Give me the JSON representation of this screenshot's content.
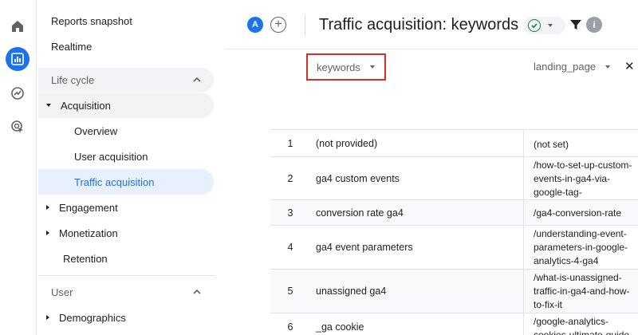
{
  "nav": {
    "top_items": [
      "Reports snapshot",
      "Realtime"
    ],
    "lifecycle": {
      "label": "Life cycle",
      "acquisition": {
        "label": "Acquisition",
        "children": [
          "Overview",
          "User acquisition",
          "Traffic acquisition"
        ]
      },
      "engagement": "Engagement",
      "monetization": "Monetization",
      "retention": "Retention"
    },
    "user": {
      "label": "User",
      "demographics": "Demographics"
    }
  },
  "header": {
    "avatar_letter": "A",
    "add_symbol": "+",
    "title": "Traffic acquisition: keywords",
    "info_symbol": "i"
  },
  "dimensions": {
    "primary": "keywords",
    "secondary": "landing_page",
    "close_symbol": "✕"
  },
  "table": {
    "rows": [
      {
        "n": "1",
        "keyword": "(not provided)",
        "landing": "(not set)"
      },
      {
        "n": "2",
        "keyword": "ga4 custom events",
        "landing": "/how-to-set-up-custom-events-in-ga4-via-google-tag-"
      },
      {
        "n": "3",
        "keyword": "conversion rate ga4",
        "landing": "/ga4-conversion-rate"
      },
      {
        "n": "4",
        "keyword": "ga4 event parameters",
        "landing": "/understanding-event-parameters-in-google-analytics-4-ga4"
      },
      {
        "n": "5",
        "keyword": "unassigned ga4",
        "landing": "/what-is-unassigned-traffic-in-ga4-and-how-to-fix-it"
      },
      {
        "n": "6",
        "keyword": "_ga cookie",
        "landing": "/google-analytics-cookies-ultimate-guide"
      }
    ]
  },
  "colors": {
    "accent": "#1a73e8",
    "highlight_border": "#d93025",
    "status_ok": "#188038"
  },
  "icons": [
    "home-icon",
    "reports-icon",
    "explore-icon",
    "advertising-icon",
    "check-circle-icon",
    "filter-icon",
    "info-icon"
  ]
}
